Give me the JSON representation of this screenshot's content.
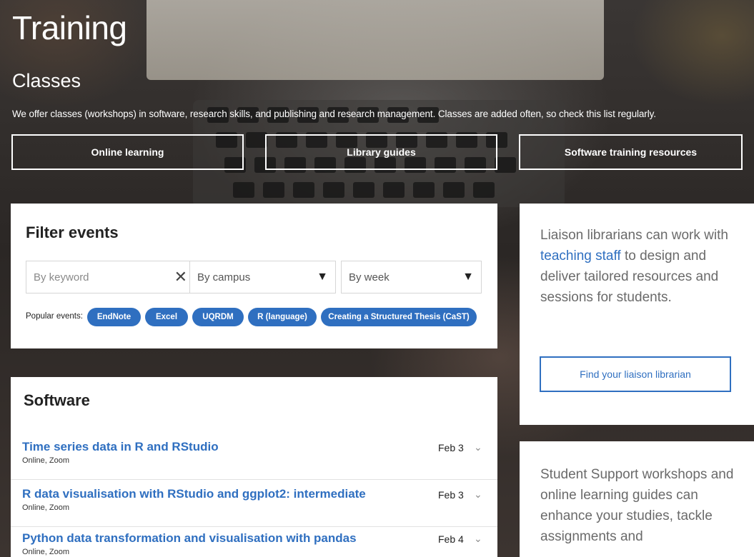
{
  "hero": {
    "title": "Training",
    "subtitle": "Classes",
    "intro": "We offer classes (workshops) in software, research skills, and publishing and research management. Classes are added often, so check this list regularly.",
    "buttons": [
      "Online learning",
      "Library guides",
      "Software training resources"
    ]
  },
  "filter": {
    "title": "Filter events",
    "keyword_placeholder": "By keyword",
    "campus_placeholder": "By campus",
    "week_placeholder": "By week",
    "popular_label": "Popular events:",
    "popular": [
      "EndNote",
      "Excel",
      "UQRDM",
      "R (language)",
      "Creating a Structured Thesis (CaST)"
    ]
  },
  "software": {
    "title": "Software",
    "events": [
      {
        "title": "Time series data in R and RStudio",
        "location": "Online, Zoom",
        "date": "Feb 3"
      },
      {
        "title": "R data visualisation with RStudio and ggplot2: intermediate",
        "location": "Online, Zoom",
        "date": "Feb 3"
      },
      {
        "title": "Python data transformation and visualisation with pandas",
        "location": "Online, Zoom",
        "date": "Feb 4"
      }
    ]
  },
  "liaison": {
    "text_before": "Liaison librarians can work with ",
    "link": "teaching staff",
    "text_after": " to design and deliver tailored resources and sessions for students.",
    "button": "Find your liaison librarian"
  },
  "support": {
    "text": "Student Support workshops and online learning guides can enhance your studies, tackle assignments and"
  },
  "colors": {
    "accent": "#2f6fc0",
    "chip_bg": "#2f6fc0"
  }
}
